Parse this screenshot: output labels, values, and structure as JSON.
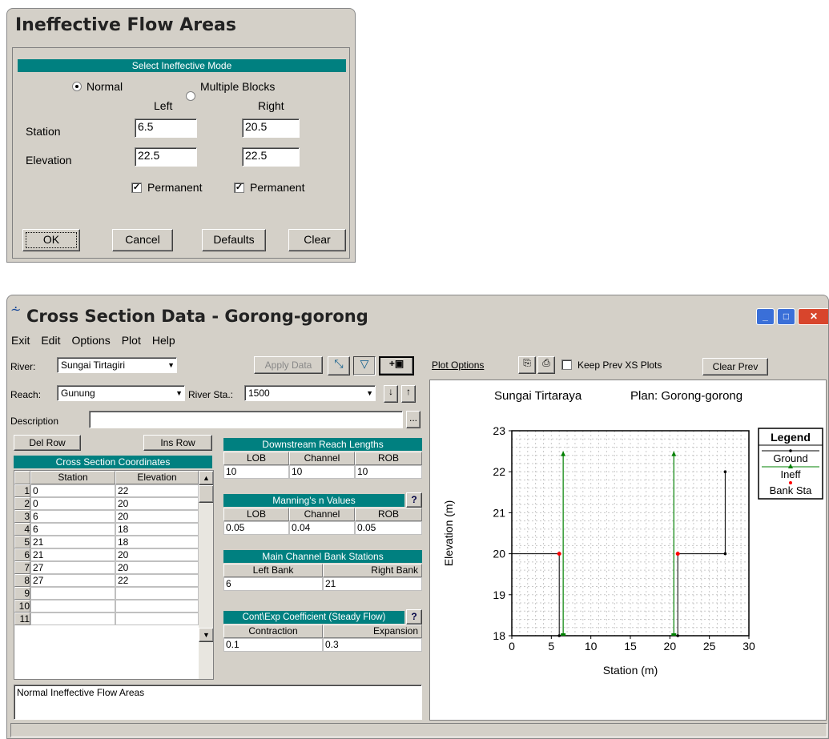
{
  "ineff": {
    "title": "Ineffective Flow Areas",
    "mode_header": "Select Ineffective Mode",
    "mode_normal": "Normal",
    "mode_multiple": "Multiple Blocks",
    "col_left": "Left",
    "col_right": "Right",
    "station_label": "Station",
    "elevation_label": "Elevation",
    "station_left": "6.5",
    "station_right": "20.5",
    "elev_left": "22.5",
    "elev_right": "22.5",
    "permanent": "Permanent",
    "ok": "OK",
    "cancel": "Cancel",
    "defaults": "Defaults",
    "clear": "Clear"
  },
  "xs": {
    "title": "Cross Section Data - Gorong-gorong",
    "menu": [
      "Exit",
      "Edit",
      "Options",
      "Plot",
      "Help"
    ],
    "river_label": "River:",
    "river": "Sungai Tirtagiri",
    "reach_label": "Reach:",
    "reach": "Gunung",
    "riversta_label": "River Sta.:",
    "riversta": "1500",
    "apply": "Apply Data",
    "desc_label": "Description",
    "desc": "",
    "del_row": "Del Row",
    "ins_row": "Ins Row",
    "coords": {
      "title": "Cross Section Coordinates",
      "col_station": "Station",
      "col_elevation": "Elevation",
      "rows": [
        [
          "1",
          "0",
          "22"
        ],
        [
          "2",
          "0",
          "20"
        ],
        [
          "3",
          "6",
          "20"
        ],
        [
          "4",
          "6",
          "18"
        ],
        [
          "5",
          "21",
          "18"
        ],
        [
          "6",
          "21",
          "20"
        ],
        [
          "7",
          "27",
          "20"
        ],
        [
          "8",
          "27",
          "22"
        ],
        [
          "9",
          "",
          ""
        ],
        [
          "10",
          "",
          ""
        ],
        [
          "11",
          "",
          ""
        ]
      ]
    },
    "downstream": {
      "title": "Downstream Reach Lengths",
      "lob": "LOB",
      "channel": "Channel",
      "rob": "ROB",
      "v_lob": "10",
      "v_channel": "10",
      "v_rob": "10"
    },
    "mannings": {
      "title": "Manning's n Values",
      "lob": "LOB",
      "channel": "Channel",
      "rob": "ROB",
      "v_lob": "0.05",
      "v_channel": "0.04",
      "v_rob": "0.05"
    },
    "bank": {
      "title": "Main Channel Bank Stations",
      "left": "Left Bank",
      "right": "Right Bank",
      "v_left": "6",
      "v_right": "21"
    },
    "contexp": {
      "title": "Cont\\Exp Coefficient (Steady Flow)",
      "contraction": "Contraction",
      "expansion": "Expansion",
      "v_contraction": "0.1",
      "v_expansion": "0.3"
    },
    "status_text": "Normal Ineffective Flow Areas",
    "plot_options": "Plot Options",
    "keep_prev": "Keep Prev XS Plots",
    "clear_prev": "Clear Prev"
  },
  "chart_data": {
    "type": "line",
    "title": "Sungai Tirtaraya",
    "subtitle": "Plan: Gorong-gorong",
    "xlabel": "Station (m)",
    "ylabel": "Elevation (m)",
    "xlim": [
      0,
      30
    ],
    "ylim": [
      18,
      23
    ],
    "xticks": [
      "0",
      "5",
      "10",
      "15",
      "20",
      "25",
      "30"
    ],
    "yticks": [
      "18",
      "19",
      "20",
      "21",
      "22",
      "23"
    ],
    "grid": true,
    "legend_title": "Legend",
    "legend_position": "right",
    "series": [
      {
        "name": "Ground",
        "color": "#000000",
        "x": [
          0,
          6,
          6,
          21,
          21,
          27,
          27
        ],
        "y": [
          20,
          20,
          18,
          18,
          20,
          20,
          22
        ]
      },
      {
        "name": "Ineff",
        "color": "#008000",
        "x": [
          6.5,
          6.5
        ],
        "y": [
          18,
          22.5
        ],
        "x2": [
          20.5,
          20.5
        ],
        "y2": [
          18,
          22.5
        ]
      },
      {
        "name": "Bank Sta",
        "color": "#ff0000",
        "x": [
          6,
          21
        ],
        "y": [
          20,
          20
        ]
      }
    ]
  }
}
